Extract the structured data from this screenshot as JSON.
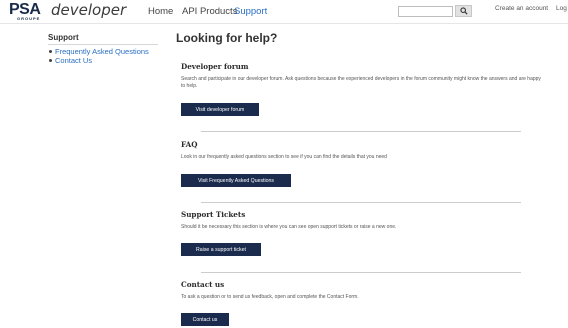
{
  "brand": {
    "psa": "PSA",
    "groupe": "GROUPE",
    "developer": "developer"
  },
  "nav": {
    "home": "Home",
    "api_products": "API Products",
    "support": "Support"
  },
  "search": {
    "value": "",
    "icon": "search-icon"
  },
  "account": {
    "create": "Create an account",
    "login": "Log"
  },
  "sidebar": {
    "title": "Support",
    "items": [
      {
        "label": "Frequently Asked Questions"
      },
      {
        "label": "Contact Us"
      }
    ]
  },
  "page": {
    "title": "Looking for help?"
  },
  "sections": [
    {
      "heading": "Developer forum",
      "text": "Search and participate in our developer forum. Ask questions because the experienced developers in the forum community might know the answers and are happy to help.",
      "button": "Visit developer forum"
    },
    {
      "heading": "FAQ",
      "text": "Look in our frequently asked questions section to see if you can find the details that you need",
      "button": "Visit Frequently Asked Questions"
    },
    {
      "heading": "Support Tickets",
      "text": "Should it be necessary this section is where you can see open support tickets or raise a new one.",
      "button": "Raise a support ticket"
    },
    {
      "heading": "Contact us",
      "text": "To ask a question or to send us feedback, open and complete the Contact Form.",
      "button": "Contact us"
    }
  ],
  "colors": {
    "accent": "#2a6fc4",
    "button_bg": "#1b2b4d"
  }
}
